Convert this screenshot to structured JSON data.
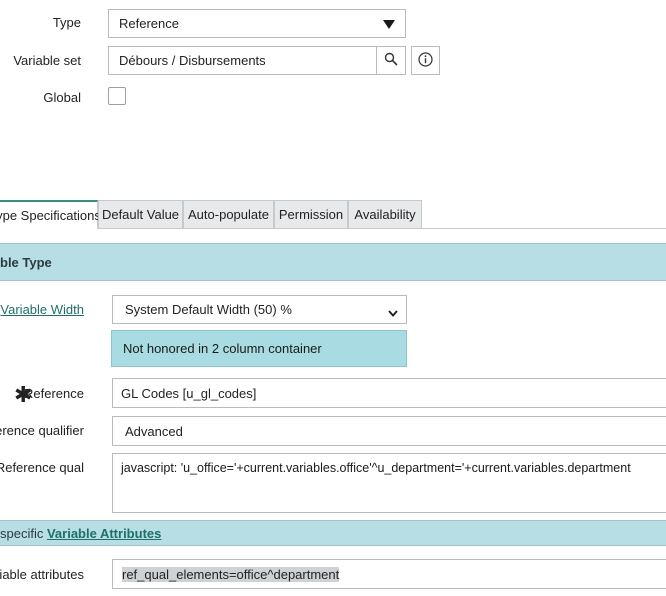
{
  "top": {
    "type_label": "Type",
    "type_value": "Reference",
    "variable_set_label": "Variable set",
    "variable_set_value": "Débours / Disbursements",
    "global_label": "Global",
    "global_checked": false
  },
  "tabs": [
    {
      "label": "ype Specifications",
      "active": true
    },
    {
      "label": "Default Value",
      "active": false
    },
    {
      "label": "Auto-populate",
      "active": false
    },
    {
      "label": "Permission",
      "active": false
    },
    {
      "label": "Availability",
      "active": false
    }
  ],
  "section_header": "ble Type",
  "form": {
    "variable_width_label": "Variable Width",
    "variable_width_value": "System Default Width (50) %",
    "info_message": "Not honored in 2 column container",
    "reference_label": "Reference",
    "reference_value": "GL Codes [u_gl_codes]",
    "reference_qualifier_label": "eference qualifier",
    "reference_qualifier_value": "Advanced",
    "reference_qual_label": "Reference qual",
    "reference_qual_value": "javascript: 'u_office='+current.variables.office'^u_department='+current.variables.department"
  },
  "attributes_band": {
    "prefix": "specific ",
    "link": "Variable Attributes"
  },
  "attributes": {
    "label": "ariable attributes",
    "value": "ref_qual_elements=office^department"
  },
  "colors": {
    "band": "#b7dde5",
    "info": "#a9dbe3",
    "link": "#1f6f6a",
    "active_tab_border": "#3a8a86"
  },
  "icons": [
    "dropdown-triangle-icon",
    "search-icon",
    "info-icon",
    "chevron-down-icon",
    "required-asterisk-icon"
  ]
}
